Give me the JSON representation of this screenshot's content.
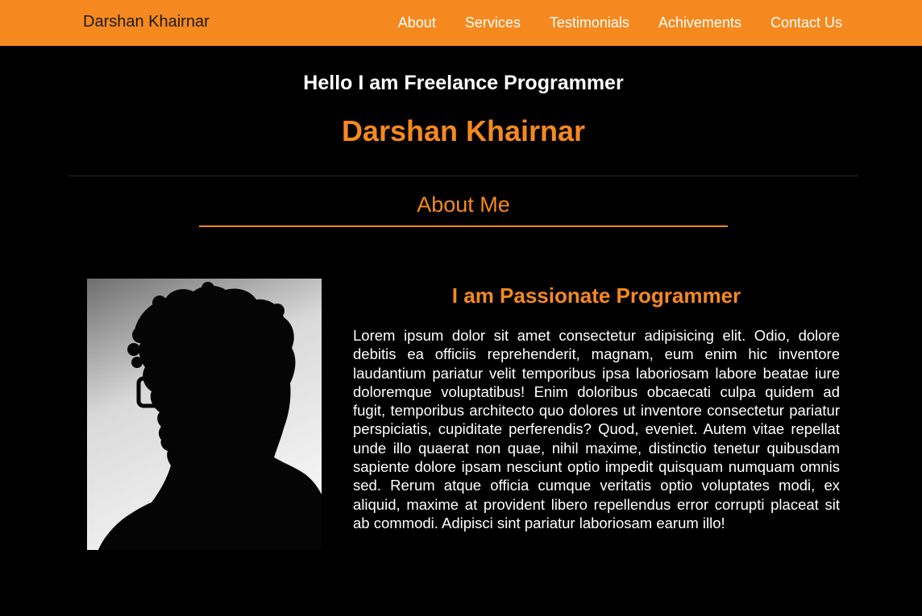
{
  "navbar": {
    "brand": "Darshan Khairnar",
    "links": [
      {
        "label": "About"
      },
      {
        "label": "Services"
      },
      {
        "label": "Testimonials"
      },
      {
        "label": "Achivements"
      },
      {
        "label": "Contact Us"
      }
    ]
  },
  "hero": {
    "subtitle": "Hello I am Freelance Programmer",
    "name": "Darshan Khairnar"
  },
  "about": {
    "section_title": "About Me",
    "heading": "I am Passionate Programmer",
    "body": "Lorem ipsum dolor sit amet consectetur adipisicing elit. Odio, dolore debitis ea officiis reprehenderit, magnam, eum enim hic inventore laudantium pariatur velit temporibus ipsa laboriosam labore beatae iure doloremque voluptatibus! Enim doloribus obcaecati culpa quidem ad fugit, temporibus architecto quo dolores ut inventore consectetur pariatur perspiciatis, cupiditate perferendis? Quod, eveniet. Autem vitae repellat unde illo quaerat non quae, nihil maxime, distinctio tenetur quibusdam sapiente dolore ipsam nesciunt optio impedit quisquam numquam omnis sed. Rerum atque officia cumque veritatis optio voluptates modi, ex aliquid, maxime at provident libero repellendus error corrupti placeat sit ab commodi. Adipisci sint pariatur laboriosam earum illo!"
  },
  "colors": {
    "accent": "#f5891f",
    "background": "#000000",
    "text": "#ffffff"
  }
}
